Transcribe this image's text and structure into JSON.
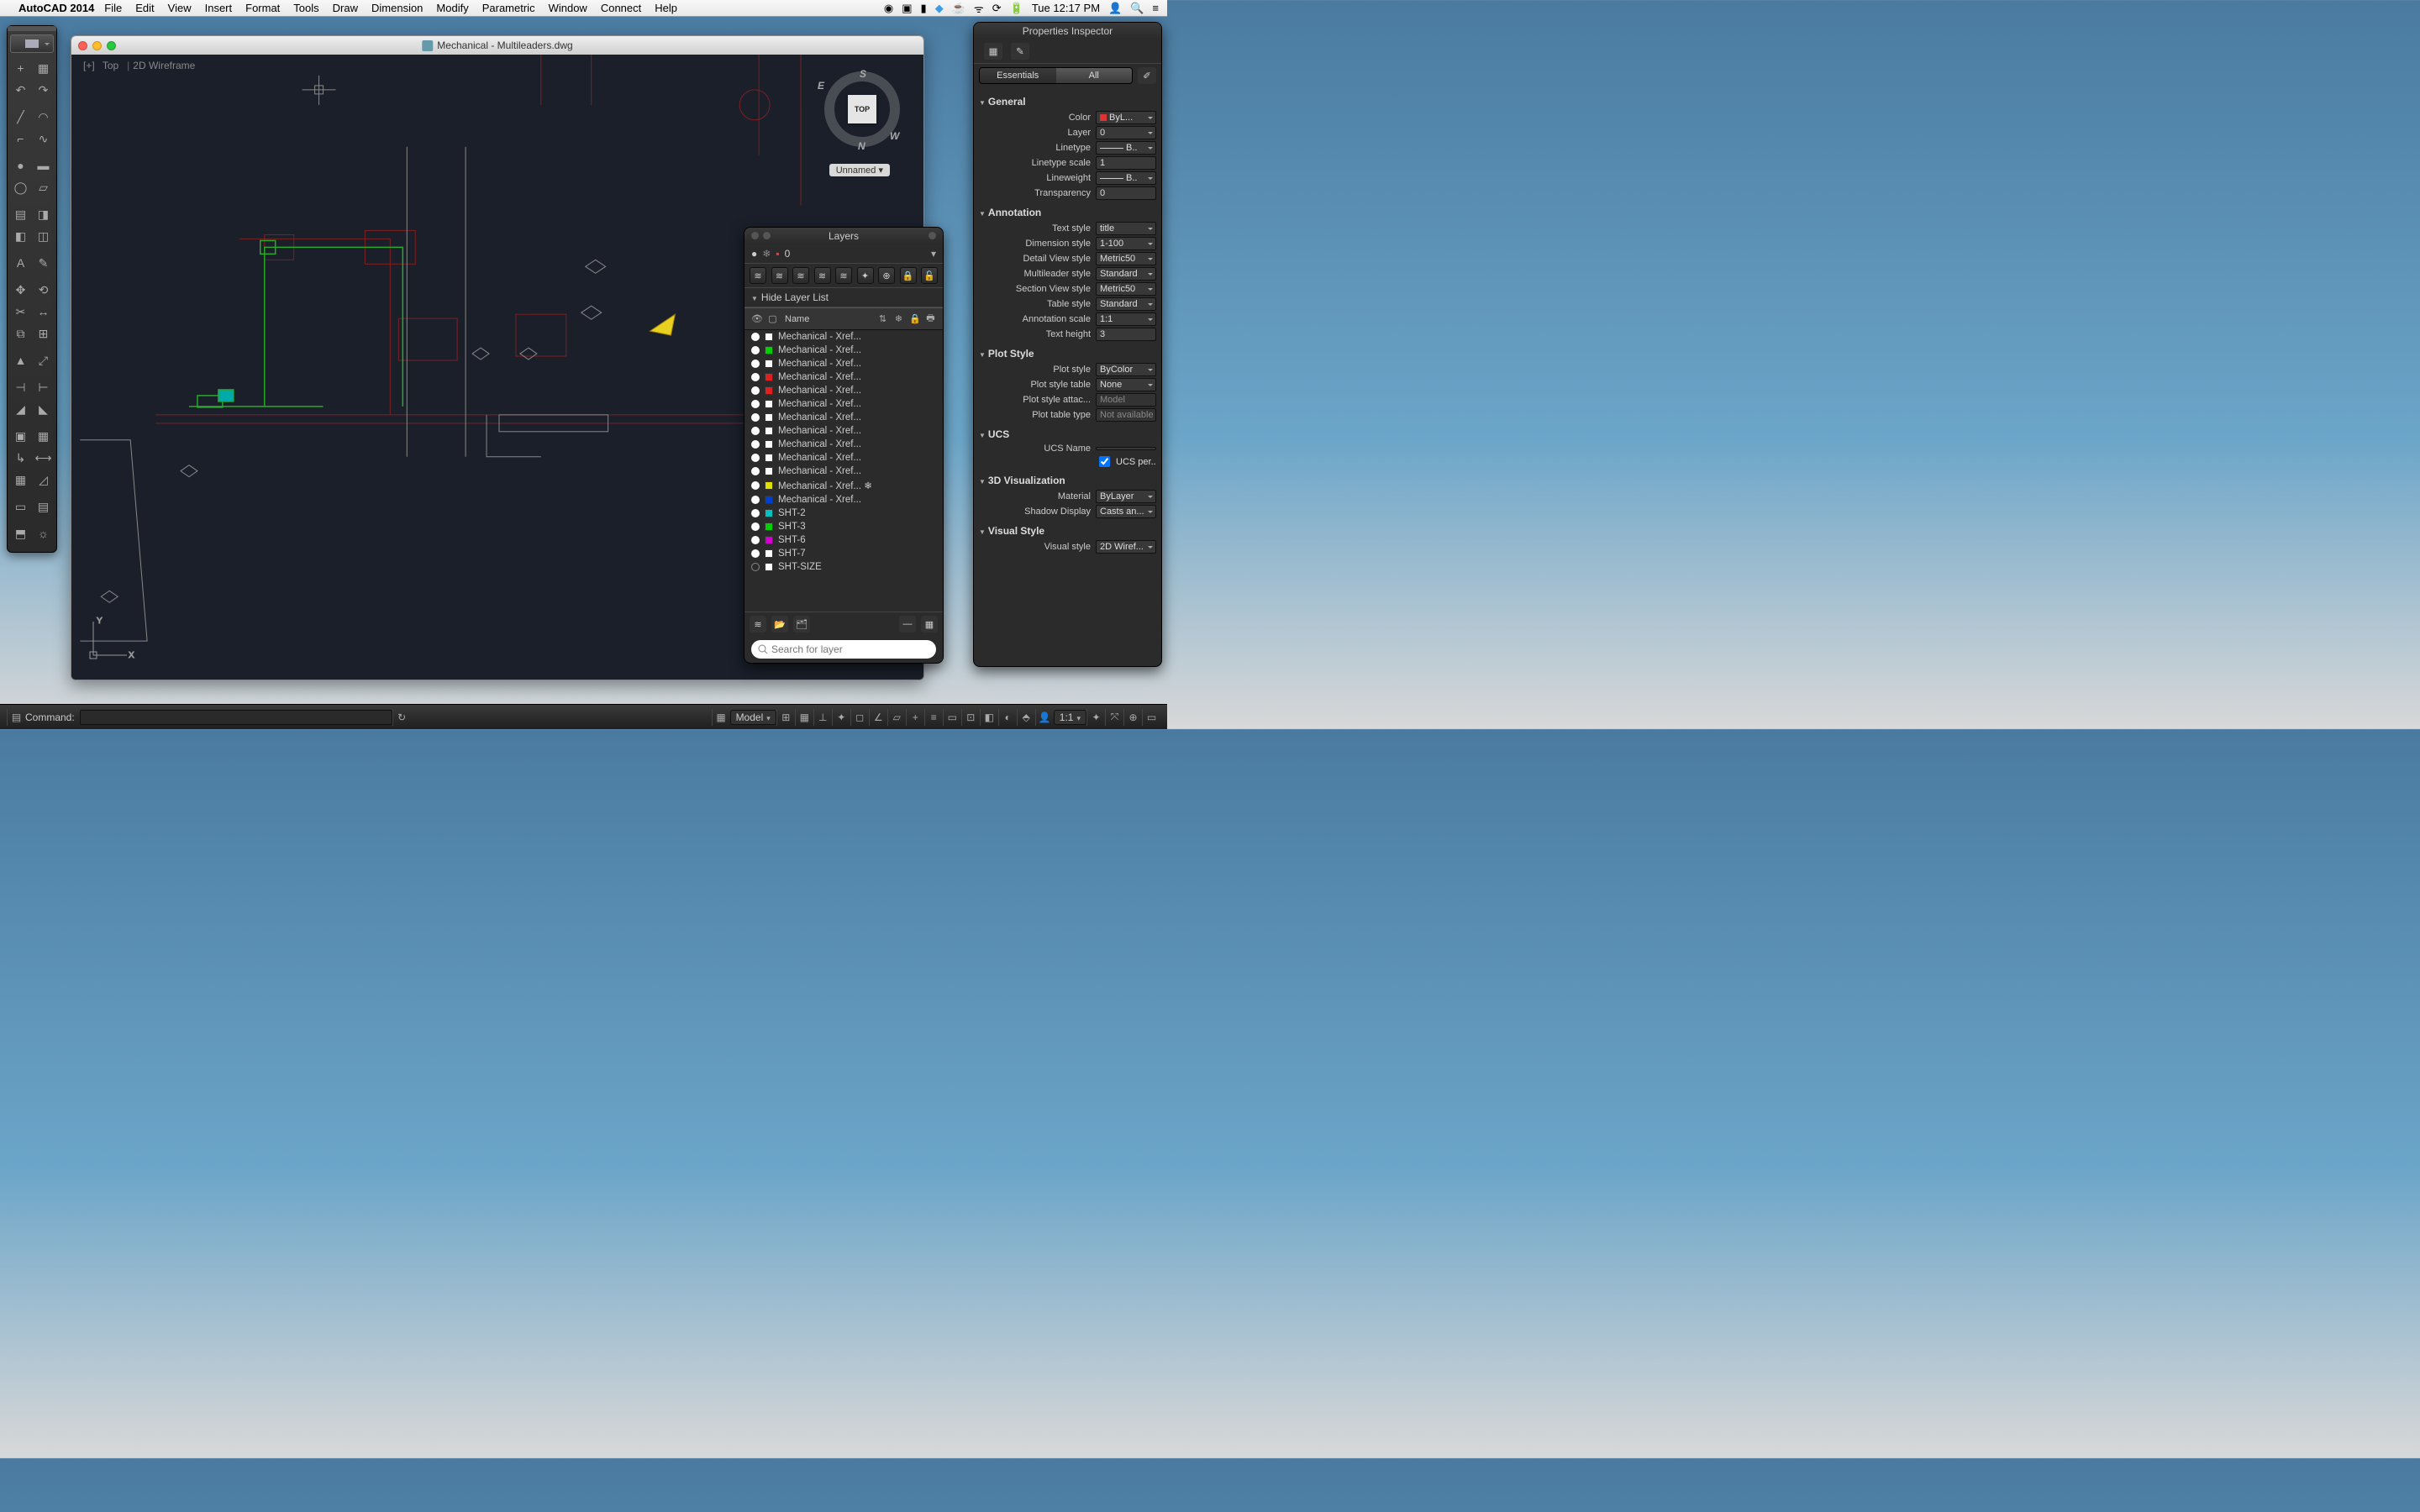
{
  "menubar": {
    "app_name": "AutoCAD 2014",
    "items": [
      "File",
      "Edit",
      "View",
      "Insert",
      "Format",
      "Tools",
      "Draw",
      "Dimension",
      "Modify",
      "Parametric",
      "Window",
      "Connect",
      "Help"
    ],
    "clock": "Tue 12:17 PM"
  },
  "document": {
    "title": "Mechanical - Multileaders.dwg",
    "view_label_left": "Top",
    "view_label_right": "2D Wireframe",
    "viewcube_face": "TOP",
    "viewcube_compass": {
      "n": "N",
      "s": "S",
      "e": "E",
      "w": "W"
    },
    "unnamed_tag": "Unnamed"
  },
  "layers_panel": {
    "title": "Layers",
    "current_layer": "0",
    "collapse_label": "Hide Layer List",
    "header_name": "Name",
    "search_placeholder": "Search for layer",
    "rows": [
      {
        "on": true,
        "color": "#ffffff",
        "name": "Mechanical - Xref..."
      },
      {
        "on": true,
        "color": "#00d000",
        "name": "Mechanical - Xref..."
      },
      {
        "on": true,
        "color": "#ffffff",
        "name": "Mechanical - Xref..."
      },
      {
        "on": true,
        "color": "#e02020",
        "name": "Mechanical - Xref..."
      },
      {
        "on": true,
        "color": "#e02020",
        "name": "Mechanical - Xref..."
      },
      {
        "on": true,
        "color": "#ffffff",
        "name": "Mechanical - Xref..."
      },
      {
        "on": true,
        "color": "#ffffff",
        "name": "Mechanical - Xref..."
      },
      {
        "on": true,
        "color": "#ffffff",
        "name": "Mechanical - Xref..."
      },
      {
        "on": true,
        "color": "#ffffff",
        "name": "Mechanical - Xref..."
      },
      {
        "on": true,
        "color": "#ffffff",
        "name": "Mechanical - Xref..."
      },
      {
        "on": true,
        "color": "#ffffff",
        "name": "Mechanical - Xref..."
      },
      {
        "on": true,
        "color": "#e0e000",
        "name": "Mechanical - Xref... ❄"
      },
      {
        "on": true,
        "color": "#0040d0",
        "name": "Mechanical - Xref..."
      },
      {
        "on": true,
        "color": "#00c0c0",
        "name": "SHT-2"
      },
      {
        "on": true,
        "color": "#00d000",
        "name": "SHT-3"
      },
      {
        "on": true,
        "color": "#d000d0",
        "name": "SHT-6"
      },
      {
        "on": true,
        "color": "#ffffff",
        "name": "SHT-7"
      },
      {
        "on": false,
        "color": "#ffffff",
        "name": "SHT-SIZE"
      }
    ]
  },
  "inspector": {
    "title": "Properties Inspector",
    "tab_essentials": "Essentials",
    "tab_all": "All",
    "sections": {
      "general": {
        "title": "General",
        "color_label": "Color",
        "color_value": "ByL...",
        "layer_label": "Layer",
        "layer_value": "0",
        "linetype_label": "Linetype",
        "linetype_value": "B..",
        "linetype_scale_label": "Linetype scale",
        "linetype_scale_value": "1",
        "lineweight_label": "Lineweight",
        "lineweight_value": "B..",
        "transparency_label": "Transparency",
        "transparency_value": "0"
      },
      "annotation": {
        "title": "Annotation",
        "text_style_label": "Text style",
        "text_style_value": "title",
        "dim_style_label": "Dimension style",
        "dim_style_value": "1-100",
        "detail_label": "Detail View style",
        "detail_value": "Metric50",
        "mleader_label": "Multileader style",
        "mleader_value": "Standard",
        "section_label": "Section View style",
        "section_value": "Metric50",
        "table_label": "Table style",
        "table_value": "Standard",
        "ascale_label": "Annotation scale",
        "ascale_value": "1:1",
        "theight_label": "Text height",
        "theight_value": "3"
      },
      "plot": {
        "title": "Plot Style",
        "pstyle_label": "Plot style",
        "pstyle_value": "ByColor",
        "ptable_label": "Plot style table",
        "ptable_value": "None",
        "pattach_label": "Plot style attac...",
        "pattach_value": "Model",
        "ptype_label": "Plot table type",
        "ptype_value": "Not available"
      },
      "ucs": {
        "title": "UCS",
        "name_label": "UCS Name",
        "name_value": "",
        "per_label": "UCS per..."
      },
      "viz": {
        "title": "3D Visualization",
        "mat_label": "Material",
        "mat_value": "ByLayer",
        "shadow_label": "Shadow Display",
        "shadow_value": "Casts an..."
      },
      "vstyle": {
        "title": "Visual Style",
        "vs_label": "Visual style",
        "vs_value": "2D Wiref..."
      }
    }
  },
  "bottombar": {
    "command_label": "Command:",
    "model_label": "Model",
    "scale_label": "1:1"
  }
}
